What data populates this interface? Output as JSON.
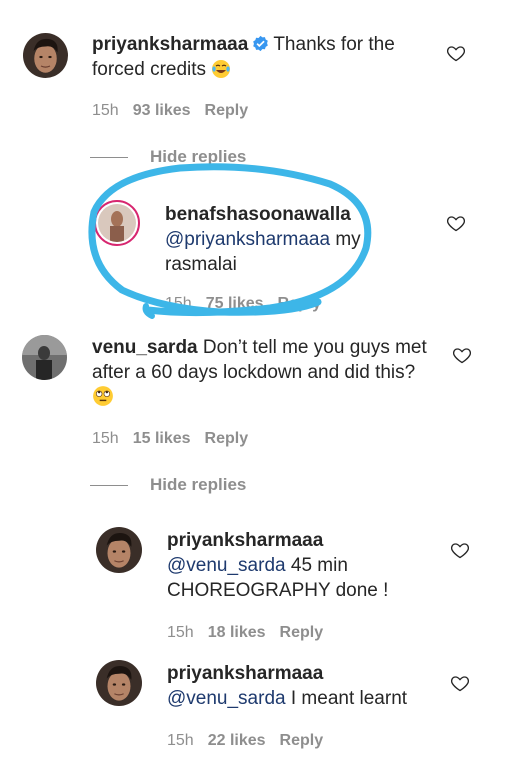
{
  "comments": [
    {
      "username": "priyanksharmaaa",
      "verified": true,
      "text": "Thanks for the forced credits",
      "emoji": "laughing-tears-emoji",
      "time": "15h",
      "likes": "93 likes",
      "reply": "Reply"
    },
    {
      "username": "benafshasoonawalla",
      "mention": "@priyanksharmaaa",
      "text": "my rasmalai",
      "time": "15h",
      "likes": "75 likes",
      "reply": "Reply",
      "highlight_color": "#3db6e8"
    },
    {
      "username": "venu_sarda",
      "text": "Don’t tell me you guys met after a 60 days lockdown and did this?",
      "emoji": "eye-roll-emoji",
      "time": "15h",
      "likes": "15 likes",
      "reply": "Reply"
    },
    {
      "username": "priyanksharmaaa",
      "mention": "@venu_sarda",
      "text": "45 min CHOREOGRAPHY done !",
      "time": "15h",
      "likes": "18 likes",
      "reply": "Reply"
    },
    {
      "username": "priyanksharmaaa",
      "mention": "@venu_sarda",
      "text": "I meant learnt",
      "time": "15h",
      "likes": "22 likes",
      "reply": "Reply"
    }
  ],
  "hide_replies_label": "Hide replies",
  "colors": {
    "verified": "#3897f0",
    "meta": "#8e8e8e",
    "mention": "#1e3a6e",
    "annotation": "#3db6e8"
  }
}
